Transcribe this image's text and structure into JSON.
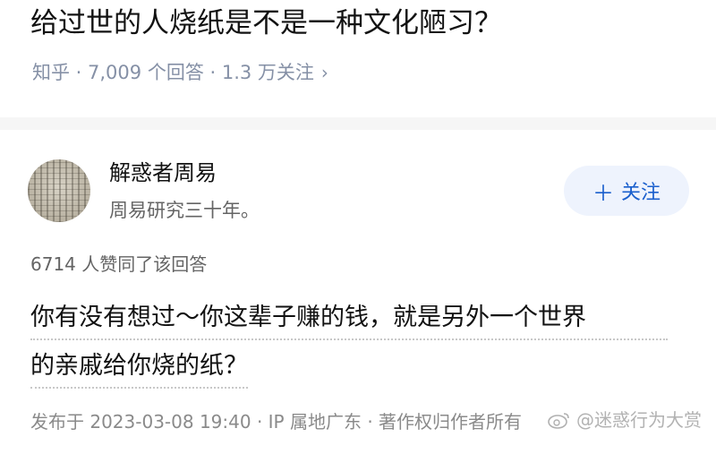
{
  "question": {
    "title": "给过世的人烧纸是不是一种文化陋习？",
    "meta": "知乎 · 7,009 个回答 · 1.3 万关注"
  },
  "author": {
    "name": "解惑者周易",
    "bio": "周易研究三十年。",
    "follow_label": "关注"
  },
  "answer": {
    "votes": "6714 人赞同了该回答",
    "line1": "你有没有想过～你这辈子赚的钱，就是另外一个世界",
    "line2": "的亲戚给你烧的纸？",
    "publish_meta": "发布于 2023-03-08 19:40 · IP 属地广东 · 著作权归作者所有"
  },
  "watermark": {
    "text": "@迷惑行为大赏"
  },
  "icons": {
    "chevron": "chevron-right-icon",
    "plus": "plus-icon",
    "weibo": "weibo-icon"
  },
  "colors": {
    "accent": "#1a5fcd",
    "follow_bg": "#eef3fd",
    "meta": "#8590a6"
  }
}
